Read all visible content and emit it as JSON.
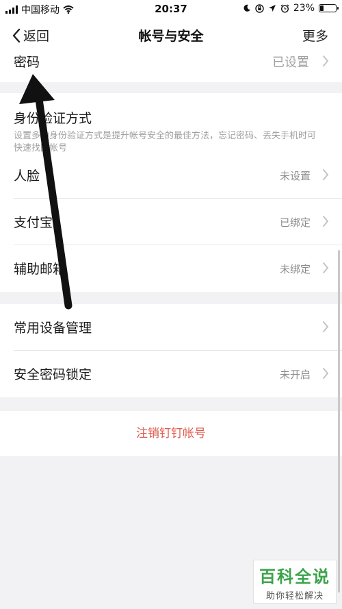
{
  "status_bar": {
    "carrier": "中国移动",
    "time": "20:37",
    "battery": "23%",
    "battery_level": 0.23,
    "icons": [
      "signal-icon",
      "wifi-icon",
      "moon-icon",
      "rotation-lock-icon",
      "location-icon",
      "alarm-icon",
      "battery-icon"
    ]
  },
  "nav": {
    "back_label": "返回",
    "title": "帐号与安全",
    "more_label": "更多"
  },
  "password_row": {
    "label": "密码",
    "value": "已设置"
  },
  "auth_section": {
    "title": "身份验证方式",
    "description": "设置多种身份验证方式是提升帐号安全的最佳方法，忘记密码、丢失手机时可快速找回帐号",
    "items": [
      {
        "label": "人脸",
        "value": "未设置"
      },
      {
        "label": "支付宝",
        "value": "已绑定"
      },
      {
        "label": "辅助邮箱",
        "value": "未绑定"
      }
    ]
  },
  "device_section": {
    "items": [
      {
        "label": "常用设备管理",
        "value": ""
      },
      {
        "label": "安全密码锁定",
        "value": "未开启"
      }
    ]
  },
  "logout_label": "注销钉钉帐号",
  "watermark": {
    "title": "百科全说",
    "subtitle": "助你轻松解决"
  },
  "colors": {
    "danger": "#e05a4e",
    "watermark": "#3aa34a",
    "muted": "#8c8c8c"
  }
}
